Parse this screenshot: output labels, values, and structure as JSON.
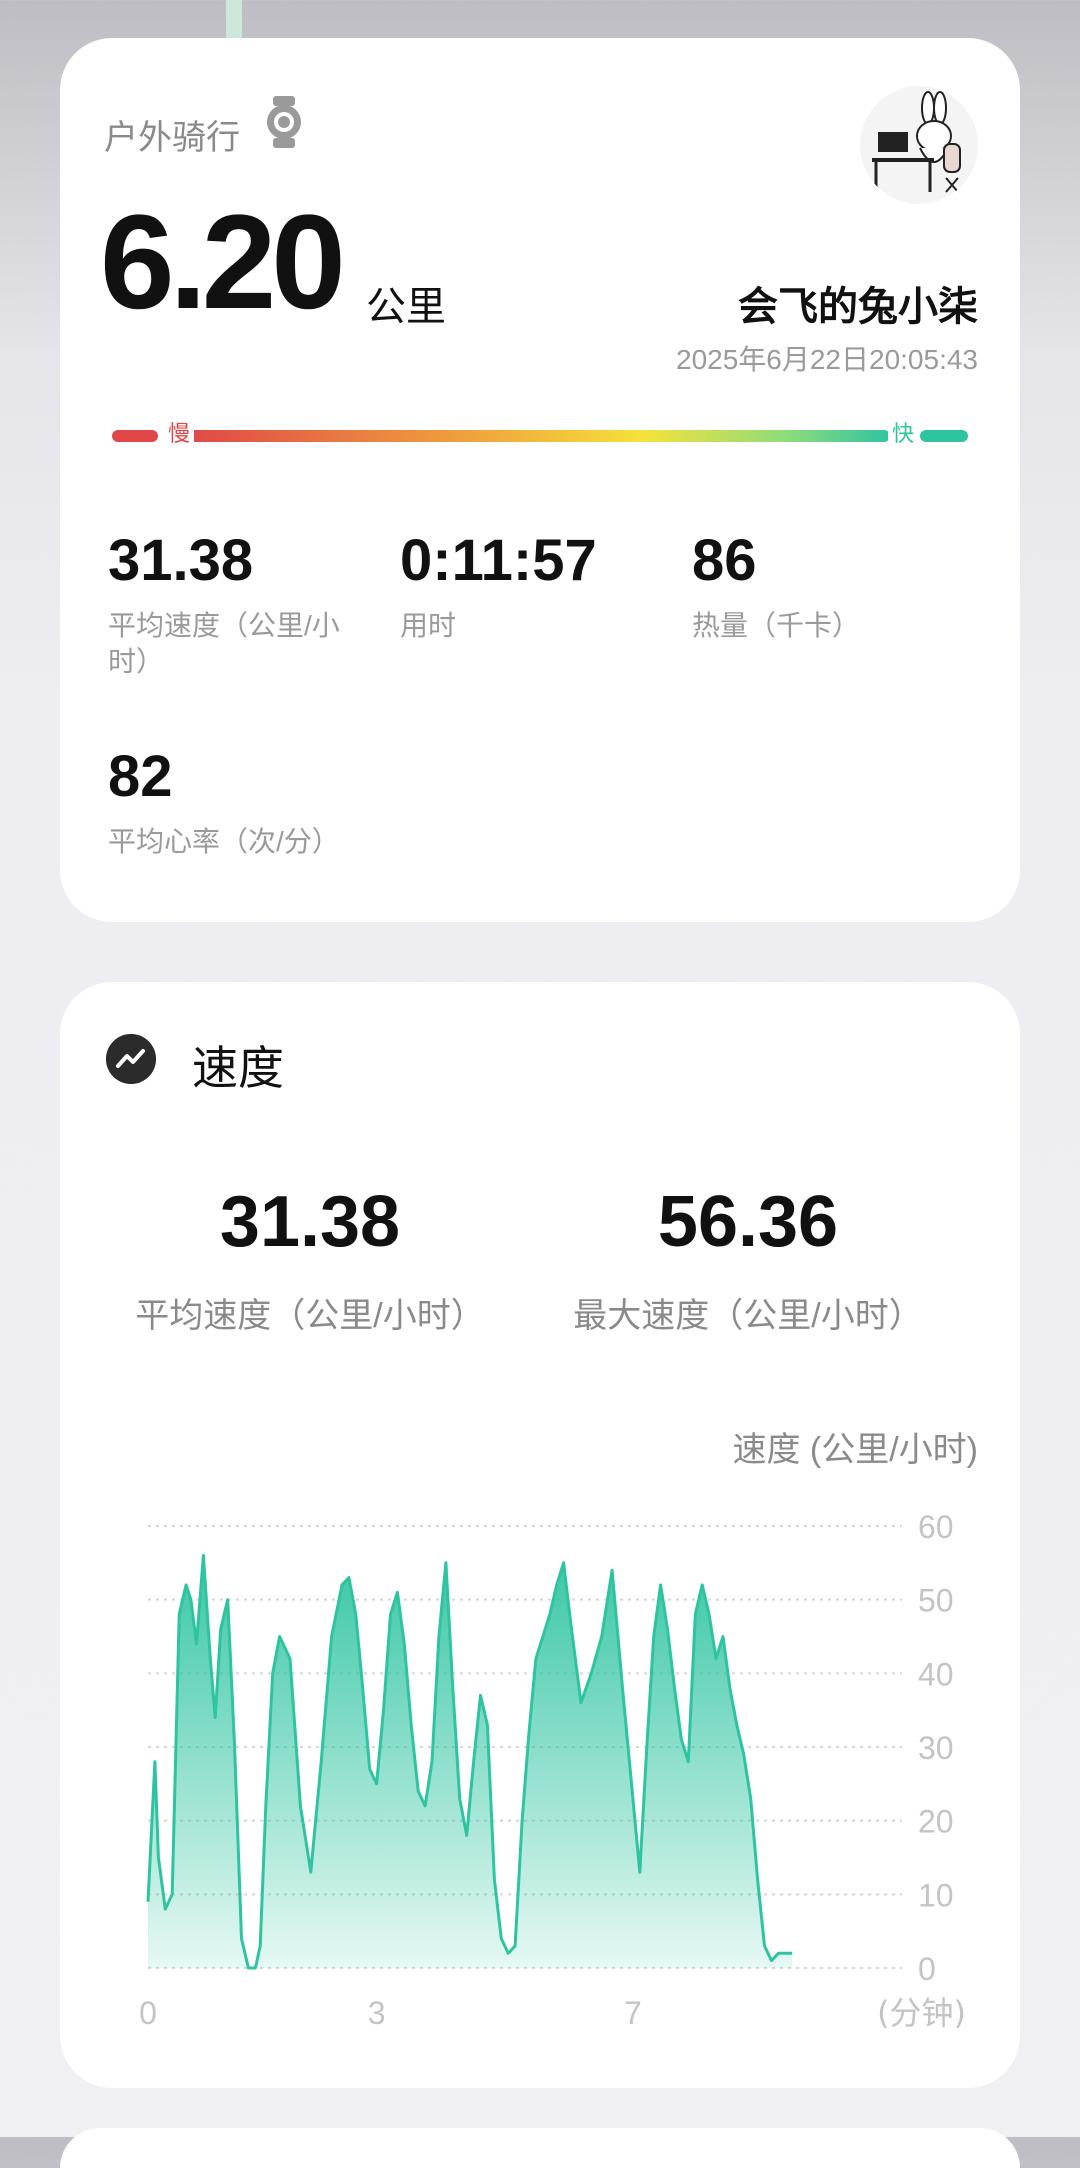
{
  "summary": {
    "activity_type": "户外骑行",
    "distance": "6.20",
    "distance_unit": "公里",
    "username": "会飞的兔小柒",
    "datetime": "2025年6月22日20:05:43",
    "pace_slow_label": "慢",
    "pace_fast_label": "快",
    "metrics": [
      {
        "value": "31.38",
        "label": "平均速度（公里/小时）"
      },
      {
        "value": "0:11:57",
        "label": "用时"
      },
      {
        "value": "86",
        "label": "热量（千卡）"
      },
      {
        "value": "82",
        "label": "平均心率（次/分）"
      }
    ],
    "colors": {
      "slow": "#e04848",
      "mid": "#f5e23c",
      "fast": "#2fc4a0"
    }
  },
  "speed_section": {
    "title": "速度",
    "icon": "trend-chart-icon",
    "avg_value": "31.38",
    "avg_label": "平均速度（公里/小时）",
    "max_value": "56.36",
    "max_label": "最大速度（公里/小时）"
  },
  "chart_data": {
    "type": "area",
    "ylabel": "速度 (公里/小时)",
    "xlabel": "(分钟)",
    "ylim": [
      0,
      60
    ],
    "y_ticks": [
      "0",
      "10",
      "20",
      "30",
      "40",
      "50",
      "60"
    ],
    "x_ticks": [
      {
        "value": 0,
        "label": "0"
      },
      {
        "value": 3.3,
        "label": "3"
      },
      {
        "value": 7.0,
        "label": "7"
      }
    ],
    "xlim": [
      0,
      11.0
    ],
    "grid": true,
    "color": "#2fc4a0",
    "x": [
      0,
      0.1,
      0.15,
      0.25,
      0.35,
      0.45,
      0.55,
      0.62,
      0.7,
      0.8,
      0.9,
      0.97,
      1.05,
      1.15,
      1.25,
      1.35,
      1.45,
      1.55,
      1.62,
      1.7,
      1.8,
      1.9,
      2.05,
      2.2,
      2.35,
      2.5,
      2.65,
      2.8,
      2.9,
      3.0,
      3.1,
      3.2,
      3.3,
      3.4,
      3.5,
      3.6,
      3.7,
      3.8,
      3.9,
      4.0,
      4.1,
      4.2,
      4.3,
      4.4,
      4.5,
      4.6,
      4.7,
      4.8,
      4.9,
      5.0,
      5.1,
      5.2,
      5.3,
      5.4,
      5.5,
      5.6,
      5.7,
      5.8,
      5.9,
      6.0,
      6.1,
      6.25,
      6.4,
      6.55,
      6.7,
      6.85,
      7.0,
      7.1,
      7.2,
      7.3,
      7.4,
      7.5,
      7.6,
      7.7,
      7.8,
      7.9,
      8.0,
      8.1,
      8.2,
      8.3,
      8.4,
      8.5,
      8.6,
      8.7,
      8.8,
      8.9,
      9.0,
      9.1,
      9.2,
      9.3,
      9.4,
      9.5,
      9.6,
      9.7,
      9.8,
      9.9,
      10.0,
      10.1,
      10.2,
      10.3,
      10.4,
      10.5,
      10.65,
      10.75,
      10.82
    ],
    "values": [
      9,
      28,
      15,
      8,
      10,
      48,
      52,
      50,
      44,
      56,
      42,
      34,
      46,
      50,
      30,
      4,
      0,
      0,
      3,
      22,
      40,
      45,
      42,
      22,
      13,
      28,
      45,
      52,
      53,
      48,
      38,
      27,
      25,
      35,
      48,
      51,
      44,
      33,
      24,
      22,
      28,
      45,
      55,
      38,
      23,
      18,
      28,
      37,
      33,
      12,
      4,
      2,
      3,
      20,
      32,
      42,
      45,
      48,
      52,
      55,
      47,
      36,
      40,
      45,
      54,
      38,
      23,
      13,
      30,
      45,
      52,
      46,
      38,
      31,
      28,
      48,
      52,
      48,
      42,
      45,
      38,
      33,
      29,
      23,
      12,
      3,
      1,
      2,
      2,
      2
    ]
  }
}
